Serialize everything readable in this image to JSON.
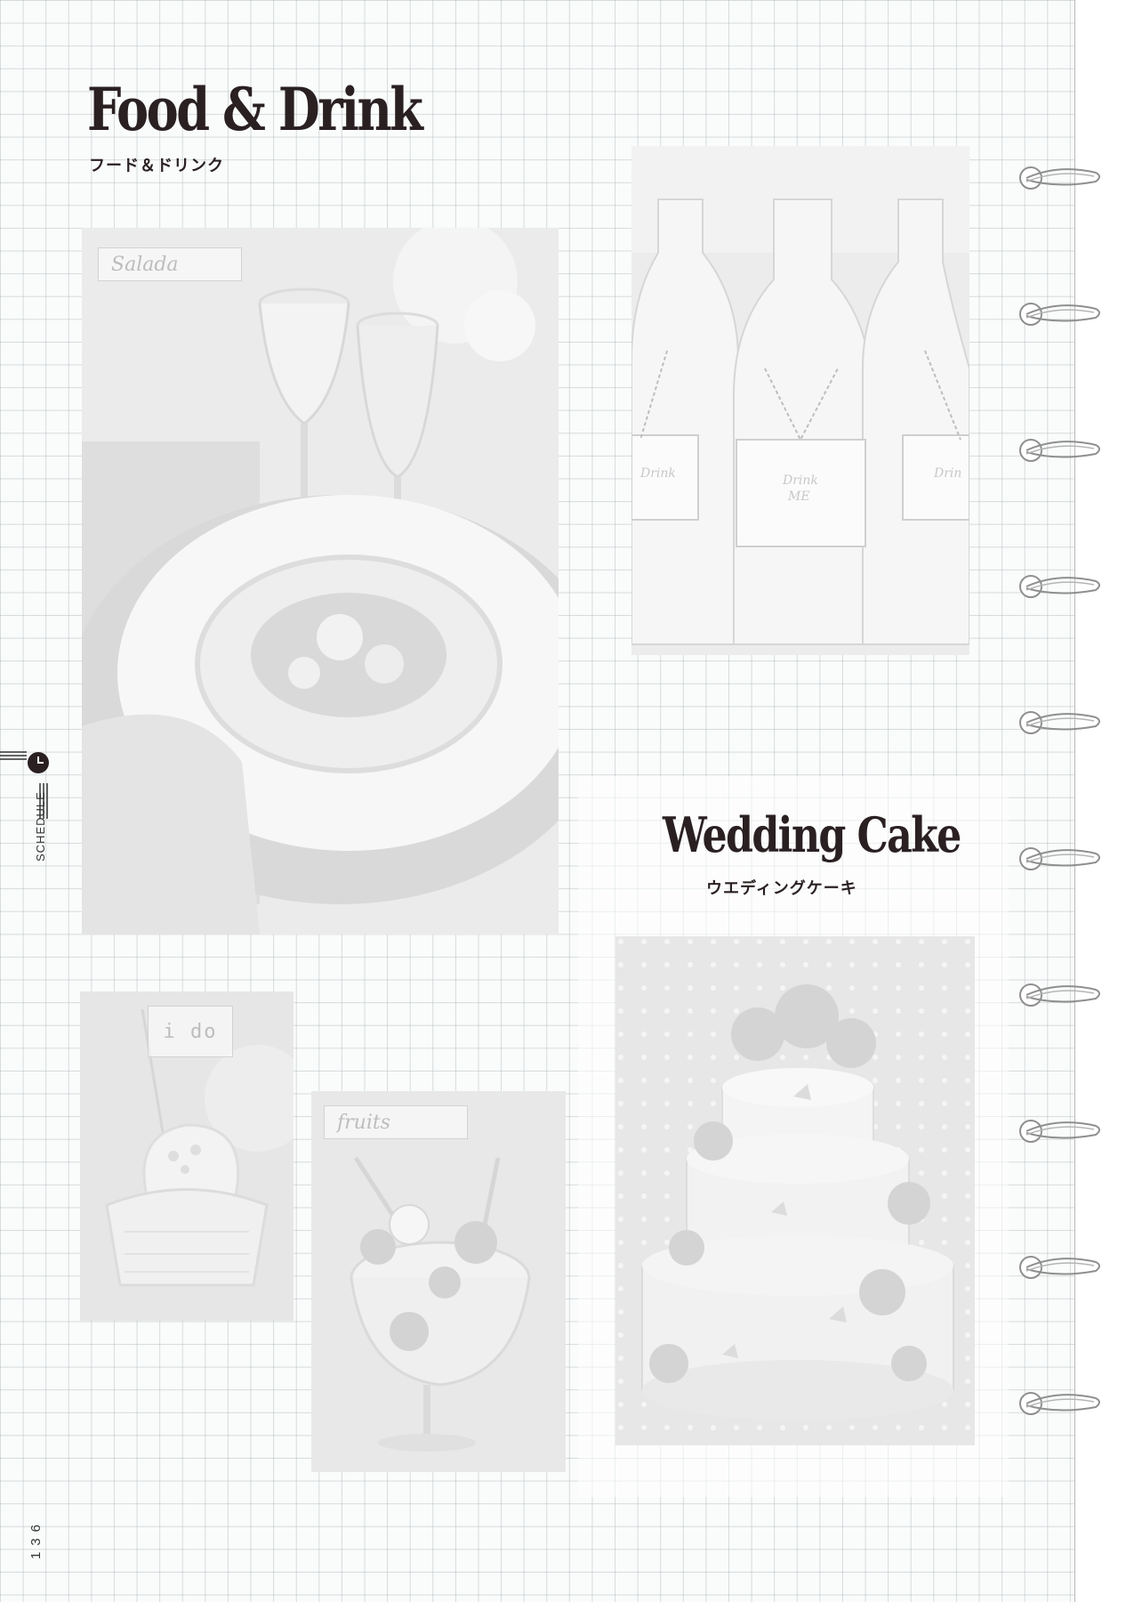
{
  "heading": {
    "title": "Food & Drink",
    "subtitle": "フード＆ドリンク"
  },
  "cake_section": {
    "title": "Wedding Cake",
    "subtitle": "ウエディングケーキ"
  },
  "photos": {
    "salad": {
      "tag": "Salada"
    },
    "bottles": {
      "card_text": "Drink ME"
    },
    "cupcake": {
      "tag": "i do"
    },
    "fruits": {
      "tag": "fruits"
    },
    "cake": {}
  },
  "side_tab": {
    "label": "SCHEDULE",
    "icon": "clock-icon"
  },
  "page_number": "136",
  "binder_rings": 10,
  "colors": {
    "ink": "#2a2022",
    "grid": "#aab4b6",
    "paper": "#fafbfb"
  }
}
